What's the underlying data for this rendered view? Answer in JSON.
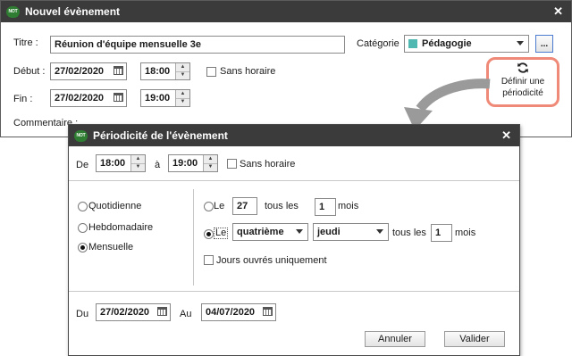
{
  "main_dialog": {
    "title": "Nouvel évènement",
    "logo": "NOT",
    "close": "✕",
    "titre_label": "Titre :",
    "titre_value": "Réunion d'équipe mensuelle 3e",
    "categorie_label": "Catégorie",
    "categorie_value": "Pédagogie",
    "categorie_color": "#4fb8b0",
    "more_button": "...",
    "debut_label": "Début :",
    "debut_date": "27/02/2020",
    "debut_time": "18:00",
    "sans_horaire": "Sans horaire",
    "fin_label": "Fin :",
    "fin_date": "27/02/2020",
    "fin_time": "19:00",
    "commentaire_label": "Commentaire :",
    "periodicite_line1": "Définir une",
    "periodicite_line2": "périodicité",
    "periodicite_icon": "refresh-icon"
  },
  "highlight_color": "#f08a78",
  "periodicite_dialog": {
    "title": "Périodicité de l'évènement",
    "logo": "NOT",
    "close": "✕",
    "de_label": "De",
    "de_time": "18:00",
    "a_label": "à",
    "a_time": "19:00",
    "sans_horaire": "Sans horaire",
    "frequencies": [
      "Quotidienne",
      "Hebdomadaire",
      "Mensuelle"
    ],
    "selected_frequency": "Mensuelle",
    "opt1": {
      "le": "Le",
      "day": "27",
      "tous_les": "tous les",
      "interval": "1",
      "mois": "mois"
    },
    "opt2": {
      "le": "Le",
      "ordinal": "quatrième",
      "weekday": "jeudi",
      "tous_les": "tous les",
      "interval": "1",
      "mois": "mois"
    },
    "jours_ouvres": "Jours ouvrés uniquement",
    "du_label": "Du",
    "du_date": "27/02/2020",
    "au_label": "Au",
    "au_date": "04/07/2020",
    "annuler": "Annuler",
    "valider": "Valider"
  }
}
